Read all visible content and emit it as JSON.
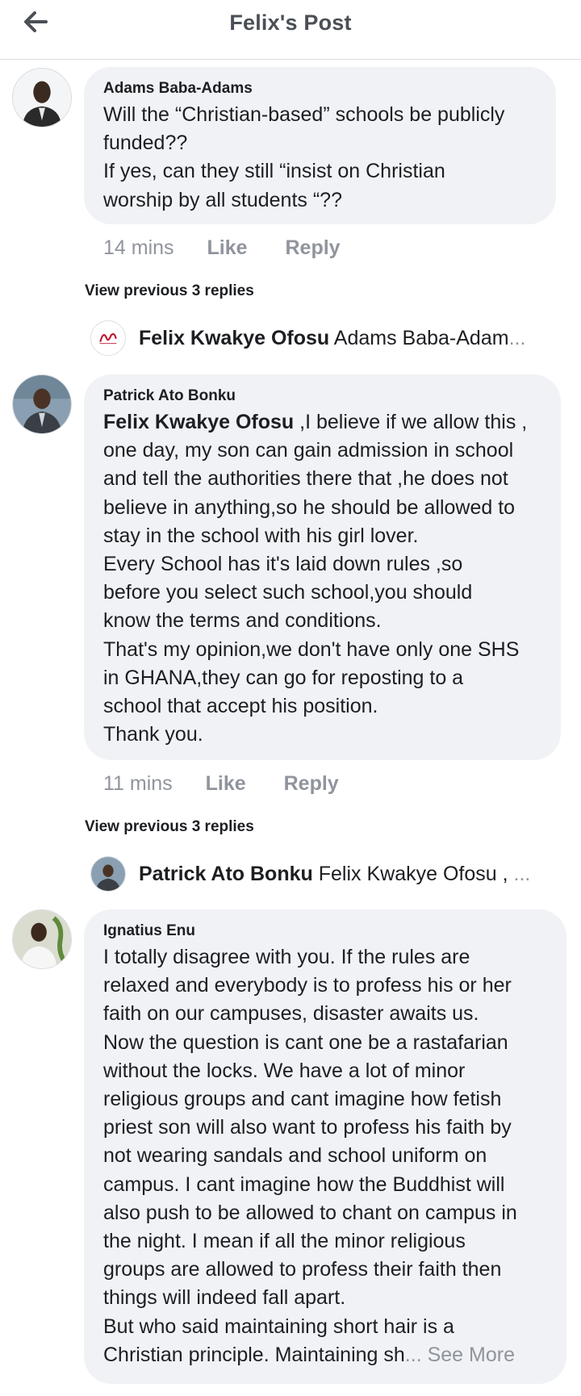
{
  "header": {
    "title": "Felix's Post",
    "back_icon": "arrow-left-icon"
  },
  "comments": [
    {
      "author": "Adams Baba-Adams",
      "lines": [
        "Will the “Christian-based” schools be publicly",
        "funded??",
        "If yes, can they still “insist on Christian",
        "worship by all students “??"
      ],
      "time": "14 mins",
      "like": "Like",
      "reply": "Reply",
      "view_replies": "View previous 3 replies",
      "reply_preview": {
        "name": "Felix Kwakye Ofosu",
        "text": "Adams Baba-Adam",
        "ellipsis": "..."
      }
    },
    {
      "author": "Patrick Ato Bonku",
      "mention": "Felix Kwakye Ofosu",
      "first_line_rest": " ,I believe if we allow this ,",
      "lines": [
        "one day, my son can gain admission in school",
        "and tell the authorities there that ,he does not",
        "believe in anything,so he should be allowed to",
        "stay in the school with his girl lover.",
        "Every School has it's laid down rules ,so",
        "before you select such school,you should",
        "know the terms and conditions.",
        "That's my opinion,we don't have only one SHS",
        "in GHANA,they can go for reposting to a",
        "school that accept his position.",
        "Thank you."
      ],
      "time": "11 mins",
      "like": "Like",
      "reply": "Reply",
      "view_replies": "View previous 3 replies",
      "reply_preview": {
        "name": "Patrick Ato Bonku",
        "text": "Felix Kwakye Ofosu ,",
        "ellipsis": " ..."
      }
    },
    {
      "author": "Ignatius Enu",
      "lines": [
        "I totally disagree with you. If the rules are",
        "relaxed and everybody is to profess his or her",
        "faith on our campuses, disaster awaits us.",
        "Now the question is cant one be a rastafarian",
        "without the locks. We have a lot of minor",
        "religious groups and cant imagine how fetish",
        "priest son will also want to profess his faith by",
        "not wearing sandals and school uniform on",
        "campus. I cant imagine how the Buddhist will",
        "also push to be allowed to chant on campus in",
        "the night. I mean if all the minor religious",
        "groups are allowed to profess their faith then",
        "things will indeed fall apart.",
        "But who said maintaining short hair is a"
      ],
      "last_line": "Christian principle. Maintaining sh",
      "see_more": "... See More"
    }
  ],
  "colors": {
    "bubble": "#f0f2f5",
    "meta": "#90949c",
    "text": "#1c1e21",
    "header_title": "#4b4f56"
  }
}
